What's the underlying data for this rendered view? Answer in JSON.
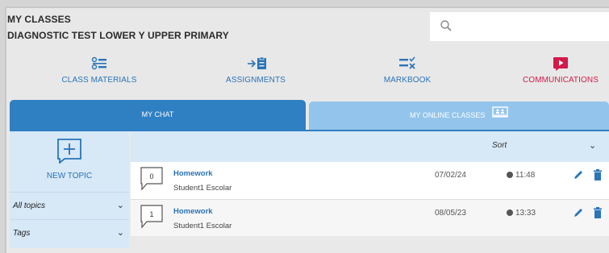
{
  "header": {
    "title": "MY CLASSES",
    "subtitle": "DIAGNOSTIC TEST LOWER Y UPPER PRIMARY"
  },
  "search": {
    "placeholder": ""
  },
  "nav": [
    {
      "label": "CLASS MATERIALS",
      "icon": "list-icon"
    },
    {
      "label": "ASSIGNMENTS",
      "icon": "assignment-icon"
    },
    {
      "label": "MARKBOOK",
      "icon": "markbook-icon"
    },
    {
      "label": "COMMUNICATIONS",
      "icon": "play-icon"
    }
  ],
  "tabs": {
    "chat": "MY CHAT",
    "online": "MY ONLINE CLASSES"
  },
  "sidebar": {
    "new_topic": "NEW TOPIC",
    "filters": [
      {
        "label": "All topics"
      },
      {
        "label": "Tags"
      }
    ]
  },
  "sort": {
    "label": "Sort"
  },
  "topics": [
    {
      "count": "0",
      "title": "Homework",
      "author": "Student1 Escolar",
      "date": "07/02/24",
      "time": "11:48"
    },
    {
      "count": "1",
      "title": "Homework",
      "author": "Student1 Escolar",
      "date": "08/05/23",
      "time": "13:33"
    }
  ],
  "colors": {
    "accent_blue": "#2f7fc3",
    "light_blue": "#93c4ec",
    "communications_red": "#d31a4a"
  }
}
